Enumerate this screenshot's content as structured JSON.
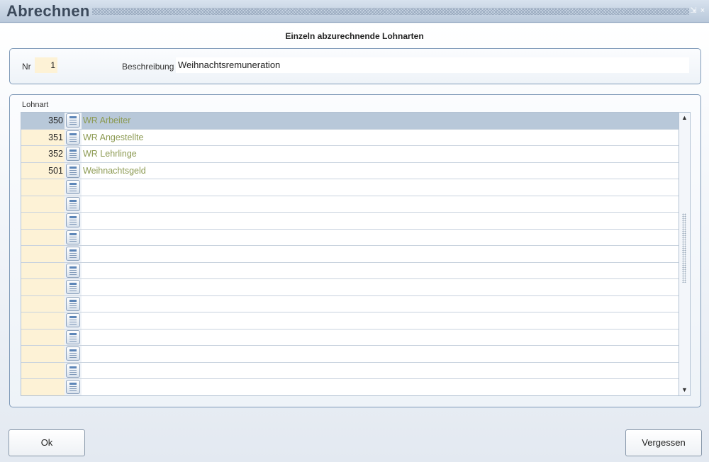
{
  "window": {
    "title": "Abrechnen",
    "restore_glyph": "⇲",
    "close_glyph": "×"
  },
  "heading": "Einzeln abzurechnende Lohnarten",
  "form": {
    "nr_label": "Nr",
    "nr_value": "1",
    "beschreibung_label": "Beschreibung",
    "beschreibung_value": "Weihnachtsremuneration"
  },
  "list": {
    "label": "Lohnart",
    "rows": [
      {
        "nr": "350",
        "text": "WR Arbeiter",
        "selected": true
      },
      {
        "nr": "351",
        "text": "WR Angestellte"
      },
      {
        "nr": "352",
        "text": "WR Lehrlinge"
      },
      {
        "nr": "501",
        "text": "Weihnachtsgeld"
      },
      {
        "nr": "",
        "text": ""
      },
      {
        "nr": "",
        "text": ""
      },
      {
        "nr": "",
        "text": ""
      },
      {
        "nr": "",
        "text": ""
      },
      {
        "nr": "",
        "text": ""
      },
      {
        "nr": "",
        "text": ""
      },
      {
        "nr": "",
        "text": ""
      },
      {
        "nr": "",
        "text": ""
      },
      {
        "nr": "",
        "text": ""
      },
      {
        "nr": "",
        "text": ""
      },
      {
        "nr": "",
        "text": ""
      },
      {
        "nr": "",
        "text": ""
      },
      {
        "nr": "",
        "text": ""
      }
    ],
    "scroll_up_glyph": "▲",
    "scroll_down_glyph": "▼"
  },
  "buttons": {
    "ok": "Ok",
    "cancel": "Vergessen"
  },
  "colors": {
    "title_text": "#3c4a5c",
    "number_cell": "#fdf2d6",
    "selected_row": "#b8c8d9",
    "description_text": "#8c9a52",
    "panel_border": "#7f9ab8"
  }
}
